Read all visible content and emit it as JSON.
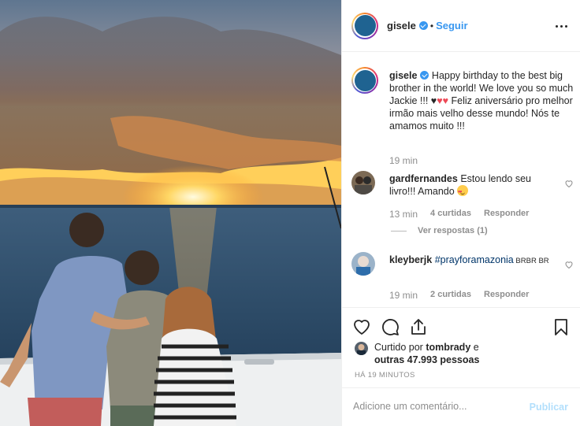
{
  "colors": {
    "accent": "#3897f0",
    "text": "#262626",
    "muted": "#8e8e8e",
    "publish_disabled": "#b2dffc",
    "heart": "#ed4956"
  },
  "post_image": {
    "icon": "sunset-boat-photo"
  },
  "header": {
    "username": "gisele",
    "separator": "•",
    "follow_label": "Seguir",
    "more_icon": "more-options-icon"
  },
  "caption": {
    "username": "gisele",
    "text_1": "Happy birthday to the best big brother in the world! We love you so much Jackie !!! ",
    "emoji_black_heart": "♥",
    "emoji_red_hearts": "♥♥",
    "text_2": " Feliz aniversário pro melhor irmão mais velho desse mundo! Nós te amamos muito !!!",
    "time": "19 min"
  },
  "comments": [
    {
      "username": "gardfernandes",
      "text": "Estou lendo seu livro!!! Amando ",
      "time": "13 min",
      "likes": "4 curtidas",
      "reply": "Responder",
      "view_replies": "Ver respostas (1)"
    },
    {
      "username": "kleyberjk",
      "hashtag": "#prayforamazonia",
      "text": " BRBR BR",
      "time": "19 min",
      "likes": "2 curtidas",
      "reply": "Responder"
    }
  ],
  "actions": {
    "like_icon": "heart-outline-icon",
    "comment_icon": "comment-icon",
    "share_icon": "share-icon",
    "save_icon": "bookmark-icon"
  },
  "likes": {
    "prefix": "Curtido por ",
    "user": "tombrady",
    "middle": " e ",
    "others": "outras 47.993 pessoas"
  },
  "posted_ago": "HÁ 19 MINUTOS",
  "add_comment": {
    "placeholder": "Adicione um comentário...",
    "publish_label": "Publicar"
  }
}
